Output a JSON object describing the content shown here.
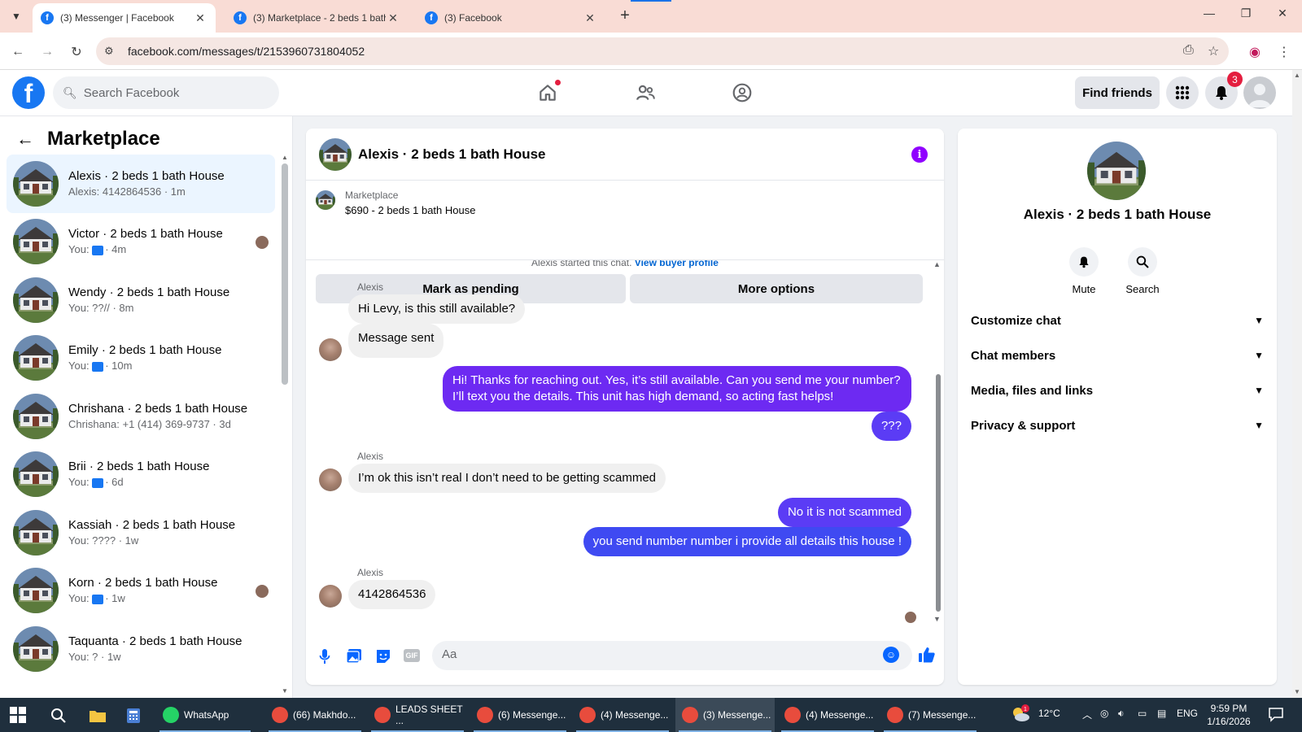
{
  "browser": {
    "tabs": [
      {
        "title": "(3) Messenger | Facebook",
        "active": true
      },
      {
        "title": "(3) Marketplace - 2 beds 1 bath",
        "active": false
      },
      {
        "title": "(3) Facebook",
        "active": false
      }
    ],
    "url": "facebook.com/messages/t/2153960731804052"
  },
  "header": {
    "search_placeholder": "Search Facebook",
    "find_friends": "Find friends",
    "notification_count": "3"
  },
  "sidebar": {
    "title": "Marketplace",
    "conversations": [
      {
        "name": "Alexis · 2 beds 1 bath House",
        "preview": "Alexis: 4142864536 · 1m",
        "selected": true
      },
      {
        "name": "Victor · 2 beds 1 bath House",
        "preview_prefix": "You:",
        "preview": "· 4m",
        "thumb": true,
        "read": true
      },
      {
        "name": "Wendy · 2 beds 1 bath House",
        "preview": "You: ??// · 8m"
      },
      {
        "name": "Emily · 2 beds 1 bath House",
        "preview_prefix": "You:",
        "preview": "· 10m",
        "thumb": true
      },
      {
        "name": "Chrishana · 2 beds 1 bath House",
        "preview": "Chrishana: +1 (414) 369-9737 · 3d"
      },
      {
        "name": "Brii · 2 beds 1 bath House",
        "preview_prefix": "You:",
        "preview": "· 6d",
        "thumb": true
      },
      {
        "name": "Kassiah · 2 beds 1 bath House",
        "preview": "You: ???? · 1w"
      },
      {
        "name": "Korn · 2 beds 1 bath House",
        "preview_prefix": "You:",
        "preview": "· 1w",
        "thumb": true,
        "read": true
      },
      {
        "name": "Taquanta · 2 beds 1 bath House",
        "preview": "You: ? · 1w"
      }
    ]
  },
  "chat": {
    "name": "Alexis · 2 beds 1 bath House",
    "listing_label": "Marketplace",
    "listing_price": "$690 - 2 beds 1 bath House",
    "mark_pending": "Mark as pending",
    "more_options": "More options",
    "system_text": "Alexis started this chat.",
    "system_link": "View buyer profile",
    "messages": {
      "sender1": "Alexis",
      "m1": "Hi Levy, is this still available?",
      "m2": "Message sent",
      "m3": "Hi! Thanks for reaching out. Yes, it’s still available. Can you send me your number? I’ll text you the details. This unit has high demand, so acting fast helps!",
      "m4": "???",
      "sender2": "Alexis",
      "m5": "I’m ok this isn’t real I don’t need to be getting scammed",
      "m6": "No it is not scammed",
      "m7": "you send number number i provide all details this house !",
      "sender3": "Alexis",
      "m8": "4142864536"
    },
    "composer_placeholder": "Aa"
  },
  "info_panel": {
    "name": "Alexis · 2 beds 1 bath House",
    "mute": "Mute",
    "search": "Search",
    "sections": [
      "Customize chat",
      "Chat members",
      "Media, files and links",
      "Privacy & support"
    ]
  },
  "taskbar": {
    "apps": [
      {
        "label": "WhatsApp",
        "color": "#25d366",
        "active": false
      },
      {
        "label": "(66) Makhdo...",
        "color": "#e84c3d",
        "active": false
      },
      {
        "label": "LEADS SHEET ...",
        "color": "#e84c3d",
        "active": false
      },
      {
        "label": "(6) Messenge...",
        "color": "#e84c3d",
        "active": false
      },
      {
        "label": "(4) Messenge...",
        "color": "#e84c3d",
        "active": false
      },
      {
        "label": "(3) Messenge...",
        "color": "#e84c3d",
        "active": true
      },
      {
        "label": "(4) Messenge...",
        "color": "#e84c3d",
        "active": false
      },
      {
        "label": "(7) Messenge...",
        "color": "#e84c3d",
        "active": false
      }
    ],
    "temperature": "12°C",
    "language": "ENG",
    "time": "9:59 PM",
    "date": "1/16/2026"
  },
  "colors": {
    "fb_blue": "#1877f2",
    "outgoing_bubble": "#6b2cf5",
    "taskbar": "#1f2f3d"
  }
}
